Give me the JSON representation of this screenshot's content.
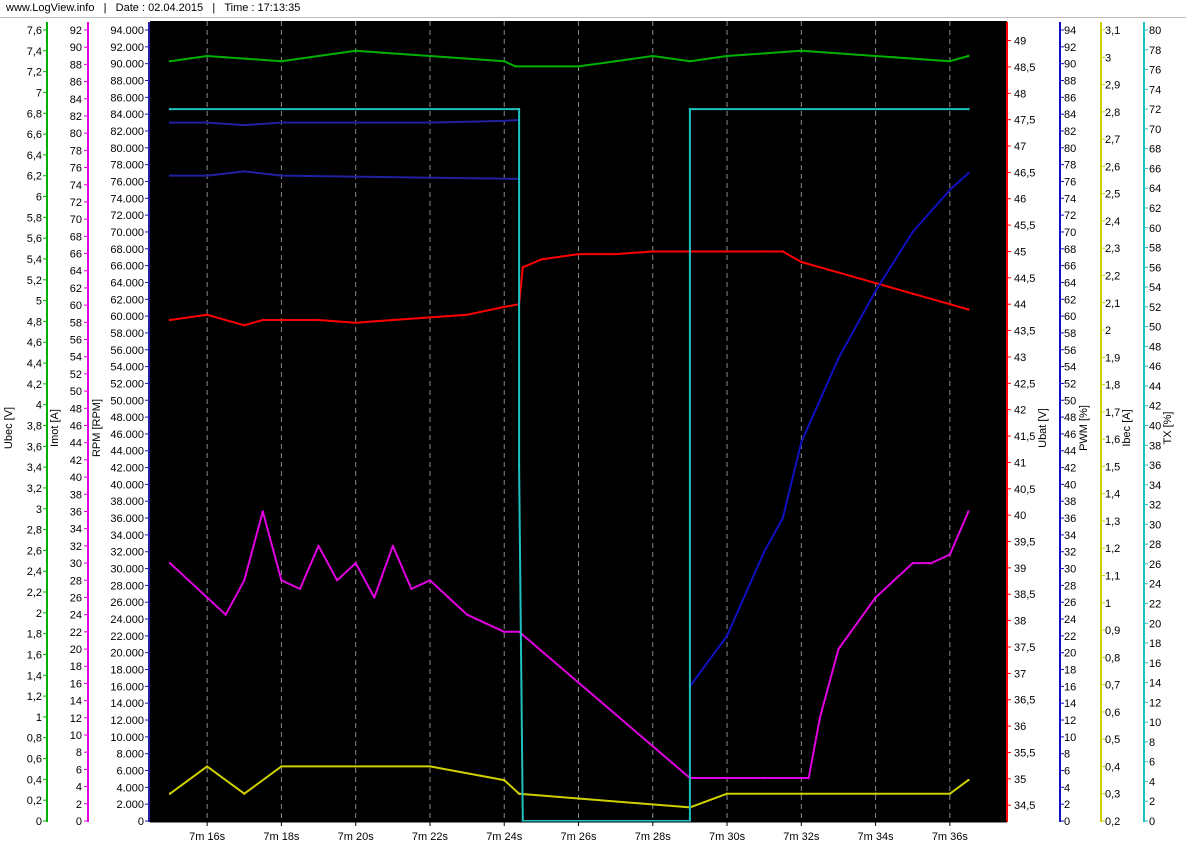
{
  "header": {
    "site": "www.LogView.info",
    "date_label": "Date : 02.04.2015",
    "time_label": "Time : 17:13:35",
    "separator": "|"
  },
  "colors": {
    "ubec": "#00b000",
    "imot": "#e000e0",
    "rpm": "#2020a0",
    "ubat": "#ff0000",
    "pwm": "#1010c0",
    "ibec": "#d0d000",
    "tx": "#20c0c0"
  },
  "chart_data": {
    "type": "line",
    "grid": "vertical dashed",
    "x_range_s": [
      435,
      457
    ],
    "x_ticks": [
      "7m 16s",
      "7m 18s",
      "7m 20s",
      "7m 22s",
      "7m 24s",
      "7m 26s",
      "7m 28s",
      "7m 30s",
      "7m 32s",
      "7m 34s",
      "7m 36s"
    ],
    "axes": {
      "ubec": {
        "title": "Ubec [V]",
        "range": [
          0,
          7.6
        ],
        "ticks": [
          "0",
          "0,2",
          "0,4",
          "0,6",
          "0,8",
          "1",
          "1,2",
          "1,4",
          "1,6",
          "1,8",
          "2",
          "2,2",
          "2,4",
          "2,6",
          "2,8",
          "3",
          "3,2",
          "3,4",
          "3,6",
          "3,8",
          "4",
          "4,2",
          "4,4",
          "4,6",
          "4,8",
          "5",
          "5,2",
          "5,4",
          "5,6",
          "5,8",
          "6",
          "6,2",
          "6,4",
          "6,6",
          "6,8",
          "7",
          "7,2",
          "7,4",
          "7,6"
        ]
      },
      "imot": {
        "title": "Imot [A]",
        "range": [
          0,
          92
        ],
        "ticks": [
          "0",
          "2",
          "4",
          "6",
          "8",
          "10",
          "12",
          "14",
          "16",
          "18",
          "20",
          "22",
          "24",
          "26",
          "28",
          "30",
          "32",
          "34",
          "36",
          "38",
          "40",
          "42",
          "44",
          "46",
          "48",
          "50",
          "52",
          "54",
          "56",
          "58",
          "60",
          "62",
          "64",
          "66",
          "68",
          "70",
          "72",
          "74",
          "76",
          "78",
          "80",
          "82",
          "84",
          "86",
          "88",
          "90",
          "92"
        ]
      },
      "rpm": {
        "title": "RPM [RPM]",
        "range": [
          0,
          94000
        ],
        "ticks": [
          "0",
          "2.000",
          "4.000",
          "6.000",
          "8.000",
          "10.000",
          "12.000",
          "14.000",
          "16.000",
          "18.000",
          "20.000",
          "22.000",
          "24.000",
          "26.000",
          "28.000",
          "30.000",
          "32.000",
          "34.000",
          "36.000",
          "38.000",
          "40.000",
          "42.000",
          "44.000",
          "46.000",
          "48.000",
          "50.000",
          "52.000",
          "54.000",
          "56.000",
          "58.000",
          "60.000",
          "62.000",
          "64.000",
          "66.000",
          "68.000",
          "70.000",
          "72.000",
          "74.000",
          "76.000",
          "78.000",
          "80.000",
          "82.000",
          "84.000",
          "86.000",
          "88.000",
          "90.000",
          "92.000",
          "94.000"
        ]
      },
      "ubat": {
        "title": "Ubat [V]",
        "range": [
          34.2,
          49.2
        ],
        "ticks": [
          "34,5",
          "35",
          "35,5",
          "36",
          "36,5",
          "37",
          "37,5",
          "38",
          "38,5",
          "39",
          "39,5",
          "40",
          "40,5",
          "41",
          "41,5",
          "42",
          "42,5",
          "43",
          "43,5",
          "44",
          "44,5",
          "45",
          "45,5",
          "46",
          "46,5",
          "47",
          "47,5",
          "48",
          "48,5",
          "49"
        ]
      },
      "pwm": {
        "title": "PWM [%]",
        "range": [
          0,
          94
        ],
        "ticks": [
          "0",
          "2",
          "4",
          "6",
          "8",
          "10",
          "12",
          "14",
          "16",
          "18",
          "20",
          "22",
          "24",
          "26",
          "28",
          "30",
          "32",
          "34",
          "36",
          "38",
          "40",
          "42",
          "44",
          "46",
          "48",
          "50",
          "52",
          "54",
          "56",
          "58",
          "60",
          "62",
          "64",
          "66",
          "68",
          "70",
          "72",
          "74",
          "76",
          "78",
          "80",
          "82",
          "84",
          "86",
          "88",
          "90",
          "92",
          "94"
        ]
      },
      "ibec": {
        "title": "Ibec [A]",
        "range": [
          0.2,
          3.1
        ],
        "ticks": [
          "0,2",
          "0,3",
          "0,4",
          "0,5",
          "0,6",
          "0,7",
          "0,8",
          "0,9",
          "1",
          "1,1",
          "1,2",
          "1,3",
          "1,4",
          "1,5",
          "1,6",
          "1,7",
          "1,8",
          "1,9",
          "2",
          "2,1",
          "2,2",
          "2,3",
          "2,4",
          "2,5",
          "2,6",
          "2,7",
          "2,8",
          "2,9",
          "3",
          "3,1"
        ]
      },
      "tx": {
        "title": "TX [%]",
        "range": [
          0,
          80
        ],
        "ticks": [
          "0",
          "2",
          "4",
          "6",
          "8",
          "10",
          "12",
          "14",
          "16",
          "18",
          "20",
          "22",
          "24",
          "26",
          "28",
          "30",
          "32",
          "34",
          "36",
          "38",
          "40",
          "42",
          "44",
          "46",
          "48",
          "50",
          "52",
          "54",
          "56",
          "58",
          "60",
          "62",
          "64",
          "66",
          "68",
          "70",
          "72",
          "74",
          "76",
          "78",
          "80"
        ]
      }
    },
    "series": [
      {
        "name": "Ubec [V]",
        "axis": "ubec",
        "points": [
          [
            435,
            7.3
          ],
          [
            436,
            7.35
          ],
          [
            438,
            7.3
          ],
          [
            440,
            7.4
          ],
          [
            442,
            7.35
          ],
          [
            444,
            7.3
          ],
          [
            444.3,
            7.25
          ],
          [
            446,
            7.25
          ],
          [
            447,
            7.3
          ],
          [
            448,
            7.35
          ],
          [
            449,
            7.3
          ],
          [
            450,
            7.35
          ],
          [
            452,
            7.4
          ],
          [
            454,
            7.35
          ],
          [
            456,
            7.3
          ],
          [
            456.5,
            7.35
          ]
        ]
      },
      {
        "name": "Imot [A]",
        "axis": "imot",
        "points": [
          [
            435,
            30
          ],
          [
            435.5,
            28
          ],
          [
            436,
            26
          ],
          [
            436.5,
            24
          ],
          [
            437,
            28
          ],
          [
            437.5,
            36
          ],
          [
            438,
            28
          ],
          [
            438.5,
            27
          ],
          [
            439,
            32
          ],
          [
            439.5,
            28
          ],
          [
            440,
            30
          ],
          [
            440.5,
            26
          ],
          [
            441,
            32
          ],
          [
            441.5,
            27
          ],
          [
            442,
            28
          ],
          [
            442.5,
            26
          ],
          [
            443,
            24
          ],
          [
            443.5,
            23
          ],
          [
            444,
            22
          ],
          [
            444.4,
            22
          ],
          [
            449,
            5
          ],
          [
            450,
            5
          ],
          [
            451,
            5
          ],
          [
            452,
            5
          ],
          [
            452.2,
            5
          ],
          [
            452.5,
            12
          ],
          [
            453,
            20
          ],
          [
            453.5,
            23
          ],
          [
            454,
            26
          ],
          [
            454.5,
            28
          ],
          [
            455,
            30
          ],
          [
            455.5,
            30
          ],
          [
            456,
            31
          ],
          [
            456.5,
            36
          ]
        ]
      },
      {
        "name": "Ubat [V]",
        "axis": "ubat",
        "points": [
          [
            435,
            43.7
          ],
          [
            436,
            43.8
          ],
          [
            437,
            43.6
          ],
          [
            437.5,
            43.7
          ],
          [
            438,
            43.7
          ],
          [
            439,
            43.7
          ],
          [
            440,
            43.65
          ],
          [
            441,
            43.7
          ],
          [
            442,
            43.75
          ],
          [
            443,
            43.8
          ],
          [
            444,
            43.95
          ],
          [
            444.4,
            44.0
          ],
          [
            444.5,
            44.7
          ],
          [
            445,
            44.85
          ],
          [
            446,
            44.95
          ],
          [
            447,
            44.95
          ],
          [
            448,
            45.0
          ],
          [
            449,
            45.0
          ],
          [
            450,
            45.0
          ],
          [
            451,
            45.0
          ],
          [
            451.5,
            45.0
          ],
          [
            452,
            44.8
          ],
          [
            453,
            44.6
          ],
          [
            454,
            44.4
          ],
          [
            455,
            44.2
          ],
          [
            456,
            44.0
          ],
          [
            456.5,
            43.9
          ]
        ]
      },
      {
        "name": "PWM [%]",
        "axis": "pwm",
        "points": [
          [
            449,
            16
          ],
          [
            450,
            22
          ],
          [
            451,
            32
          ],
          [
            451.5,
            36
          ],
          [
            452,
            45
          ],
          [
            453,
            55
          ],
          [
            454,
            63
          ],
          [
            455,
            70
          ],
          [
            456,
            75
          ],
          [
            456.5,
            77
          ]
        ]
      },
      {
        "name": "RPM [RPM]",
        "axis": "rpm",
        "points": [
          [
            435,
            83000
          ],
          [
            436,
            83000
          ],
          [
            437,
            82700
          ],
          [
            438,
            83000
          ],
          [
            440,
            83000
          ],
          [
            442,
            83000
          ],
          [
            444,
            83200
          ],
          [
            444.4,
            83300
          ]
        ]
      },
      {
        "name": "RPM [RPM] 2",
        "axis": "rpm",
        "points": [
          [
            435,
            76700
          ],
          [
            436,
            76700
          ],
          [
            437,
            77200
          ],
          [
            438,
            76700
          ],
          [
            444.4,
            76300
          ]
        ]
      },
      {
        "name": "Ibec [A]",
        "axis": "ibec",
        "points": [
          [
            435,
            0.3
          ],
          [
            436,
            0.4
          ],
          [
            437,
            0.3
          ],
          [
            438,
            0.4
          ],
          [
            440,
            0.4
          ],
          [
            442,
            0.4
          ],
          [
            444,
            0.35
          ],
          [
            444.4,
            0.3
          ],
          [
            449,
            0.25
          ],
          [
            450,
            0.3
          ],
          [
            452,
            0.3
          ],
          [
            454,
            0.3
          ],
          [
            456,
            0.3
          ],
          [
            456.5,
            0.35
          ]
        ]
      },
      {
        "name": "TX [%]",
        "axis": "tx",
        "points": [
          [
            435,
            72
          ],
          [
            444.4,
            72
          ],
          [
            444.4,
            36
          ],
          [
            444.5,
            0
          ],
          [
            449,
            0
          ],
          [
            449,
            72
          ],
          [
            456.5,
            72
          ]
        ]
      }
    ]
  }
}
